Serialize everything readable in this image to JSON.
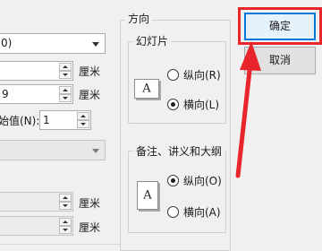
{
  "page_setup": {
    "slide_size_combo": {
      "value": "0)"
    },
    "width": {
      "value": "",
      "unit": "厘米"
    },
    "height": {
      "value": "9",
      "unit": "厘米"
    },
    "numbering": {
      "label": "编号起始值(N):",
      "label_visible": "始值(N):",
      "value": "1"
    },
    "lower_combo": {
      "value": ""
    },
    "notes_width": {
      "value": "",
      "unit": "厘米"
    },
    "notes_height": {
      "value": "",
      "unit": "厘米"
    }
  },
  "orientation": {
    "title": "方向",
    "slides": {
      "title": "幻灯片",
      "icon_letter": "A",
      "options": [
        {
          "label": "纵向(R)",
          "selected": false
        },
        {
          "label": "横向(L)",
          "selected": true
        }
      ]
    },
    "notes": {
      "title": "备注、讲义和大纲",
      "icon_letter": "A",
      "options": [
        {
          "label": "纵向(O)",
          "selected": true
        },
        {
          "label": "横向(A)",
          "selected": false
        }
      ]
    }
  },
  "buttons": {
    "ok": "确定",
    "cancel": "取消"
  },
  "annotation": {
    "highlight_color": "#e8252b",
    "arrow_color": "#e8252b"
  }
}
